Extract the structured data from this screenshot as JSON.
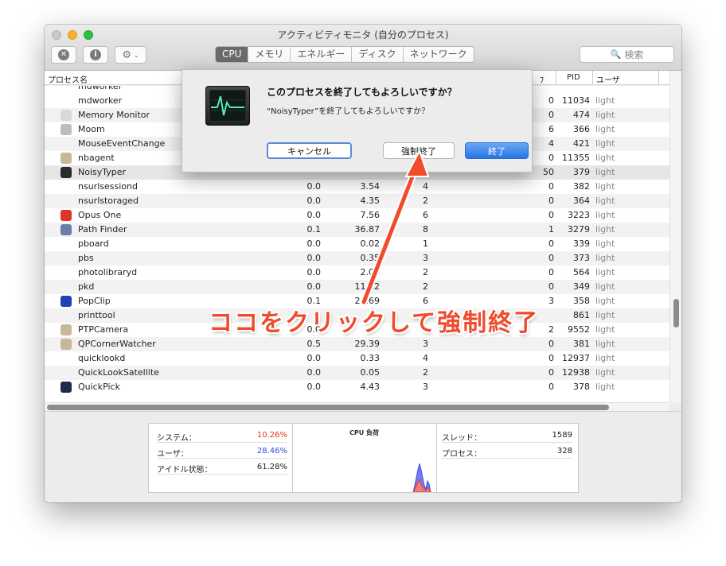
{
  "window": {
    "title": "アクティビティモニタ (自分のプロセス)"
  },
  "toolbar": {
    "stop_glyph": "✕",
    "info_glyph": "i",
    "gear_glyph": "⚙",
    "caret_glyph": "⌄",
    "tabs": [
      {
        "label": "CPU",
        "active": true
      },
      {
        "label": "メモリ",
        "active": false
      },
      {
        "label": "エネルギー",
        "active": false
      },
      {
        "label": "ディスク",
        "active": false
      },
      {
        "label": "ネットワーク",
        "active": false
      }
    ],
    "search_glyph": "🔍",
    "search_placeholder": "検索"
  },
  "table": {
    "col_process": "プロセス名",
    "col_ports_partial": "ﾌ",
    "col_pid": "PID",
    "col_user": "ユーザ",
    "rows": [
      {
        "name": "mdworker",
        "cpu": "",
        "time": "",
        "threads": "",
        "ports": "0",
        "pid": "11034",
        "user": "light",
        "icon_color": ""
      },
      {
        "name": "Memory Monitor",
        "cpu": "",
        "time": "",
        "threads": "",
        "ports": "0",
        "pid": "474",
        "user": "light",
        "icon_color": "#d8d8d8"
      },
      {
        "name": "Moom",
        "cpu": "",
        "time": "",
        "threads": "",
        "ports": "6",
        "pid": "366",
        "user": "light",
        "icon_color": "#bdbdbd"
      },
      {
        "name": "MouseEventChange",
        "cpu": "",
        "time": "",
        "threads": "",
        "ports": "4",
        "pid": "421",
        "user": "light",
        "icon_color": ""
      },
      {
        "name": "nbagent",
        "cpu": "",
        "time": "",
        "threads": "",
        "ports": "0",
        "pid": "11355",
        "user": "light",
        "icon_color": "#c8b89a"
      },
      {
        "name": "NoisyTyper",
        "cpu": "",
        "time": "",
        "threads": "",
        "ports": "50",
        "pid": "379",
        "user": "light",
        "icon_color": "#2b2b2b"
      },
      {
        "name": "nsurlsessiond",
        "cpu": "0.0",
        "time": "3.54",
        "threads": "4",
        "ports": "0",
        "pid": "382",
        "user": "light",
        "icon_color": ""
      },
      {
        "name": "nsurlstoraged",
        "cpu": "0.0",
        "time": "4.35",
        "threads": "2",
        "ports": "0",
        "pid": "364",
        "user": "light",
        "icon_color": ""
      },
      {
        "name": "Opus One",
        "cpu": "0.0",
        "time": "7.56",
        "threads": "6",
        "ports": "0",
        "pid": "3223",
        "user": "light",
        "icon_color": "#e0332b"
      },
      {
        "name": "Path Finder",
        "cpu": "0.1",
        "time": "36.87",
        "threads": "8",
        "ports": "1",
        "pid": "3279",
        "user": "light",
        "icon_color": "#6a7fa8"
      },
      {
        "name": "pboard",
        "cpu": "0.0",
        "time": "0.02",
        "threads": "1",
        "ports": "0",
        "pid": "339",
        "user": "light",
        "icon_color": ""
      },
      {
        "name": "pbs",
        "cpu": "0.0",
        "time": "0.35",
        "threads": "3",
        "ports": "0",
        "pid": "373",
        "user": "light",
        "icon_color": ""
      },
      {
        "name": "photolibraryd",
        "cpu": "0.0",
        "time": "2.04",
        "threads": "2",
        "ports": "0",
        "pid": "564",
        "user": "light",
        "icon_color": ""
      },
      {
        "name": "pkd",
        "cpu": "0.0",
        "time": "11.12",
        "threads": "2",
        "ports": "0",
        "pid": "349",
        "user": "light",
        "icon_color": ""
      },
      {
        "name": "PopClip",
        "cpu": "0.1",
        "time": "24.69",
        "threads": "6",
        "ports": "3",
        "pid": "358",
        "user": "light",
        "icon_color": "#1f3fb5"
      },
      {
        "name": "printtool",
        "cpu": "",
        "time": "",
        "threads": "",
        "ports": "",
        "pid": "861",
        "user": "light",
        "icon_color": ""
      },
      {
        "name": "PTPCamera",
        "cpu": "0.0",
        "time": "",
        "threads": "",
        "ports": "2",
        "pid": "9552",
        "user": "light",
        "icon_color": "#c8b89a"
      },
      {
        "name": "QPCornerWatcher",
        "cpu": "0.5",
        "time": "29.39",
        "threads": "3",
        "ports": "0",
        "pid": "381",
        "user": "light",
        "icon_color": "#c8b89a"
      },
      {
        "name": "quicklookd",
        "cpu": "0.0",
        "time": "0.33",
        "threads": "4",
        "ports": "0",
        "pid": "12937",
        "user": "light",
        "icon_color": ""
      },
      {
        "name": "QuickLookSatellite",
        "cpu": "0.0",
        "time": "0.05",
        "threads": "2",
        "ports": "0",
        "pid": "12938",
        "user": "light",
        "icon_color": ""
      },
      {
        "name": "QuickPick",
        "cpu": "0.0",
        "time": "4.43",
        "threads": "3",
        "ports": "0",
        "pid": "378",
        "user": "light",
        "icon_color": "#1d2a4a"
      }
    ]
  },
  "stats": {
    "system_label": "システム：",
    "system_value": "10.26%",
    "user_label": "ユーザ：",
    "user_value": "28.46%",
    "idle_label": "アイドル状態：",
    "idle_value": "61.28%",
    "cpu_load_title": "CPU 負荷",
    "threads_label": "スレッド：",
    "threads_value": "1589",
    "processes_label": "プロセス：",
    "processes_value": "328"
  },
  "dialog": {
    "title": "このプロセスを終了してもよろしいですか？",
    "message": "“NoisyTyper”を終了してもよろしいですか？",
    "cancel_label": "キャンセル",
    "force_quit_label": "強制終了",
    "quit_label": "終了"
  },
  "annotation": {
    "callout": "ココをクリックして強制終了"
  },
  "colors": {
    "system": "#e8331f",
    "user": "#2f4fd8",
    "callout": "#ef4b2d"
  }
}
